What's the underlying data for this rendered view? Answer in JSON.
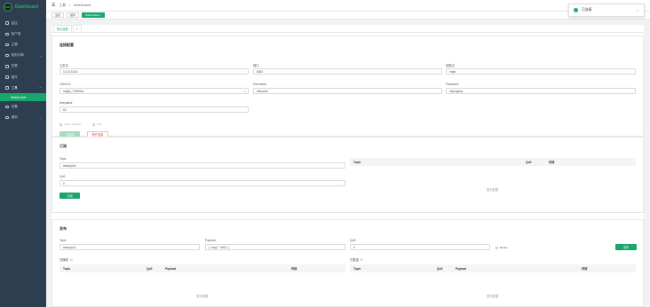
{
  "app": {
    "logo_mark": "EMQ",
    "logo_text": "Dashboard"
  },
  "sidebar": {
    "items": [
      {
        "label": "监控"
      },
      {
        "label": "客户端"
      },
      {
        "label": "主题"
      },
      {
        "label": "规则引擎"
      },
      {
        "label": "告警"
      },
      {
        "label": "插件"
      },
      {
        "label": "工具"
      },
      {
        "label": "设置"
      },
      {
        "label": "通用"
      }
    ],
    "sub_item": "WebSocket"
  },
  "header": {
    "crumb_tools": "工具",
    "separator": "/",
    "crumb_current": "WebSocket"
  },
  "tags": [
    "监控",
    "插件",
    "WebSocket"
  ],
  "tag_close": "×",
  "toast": {
    "message": "已连接",
    "close": "×",
    "check": "✓"
  },
  "connection_tabs": {
    "active": "默认连接",
    "add": "+"
  },
  "connect_card": {
    "title": "连接配置",
    "host_label": "主机名",
    "host_value": "10.10.16.81",
    "port_label": "端口",
    "port_value": "8083",
    "path_label": "挂载点",
    "path_value": "/mqtt",
    "client_id_label": "Client ID",
    "client_id_value": "mqttjs_7280f9ec",
    "username_label": "Username",
    "username_value": "hebanzhi",
    "password_label": "Password",
    "password_value": "mylongkey",
    "keepalive_label": "Keepalive",
    "keepalive_value": "60",
    "clean_session_label": "Clean Session",
    "ssl_label": "SSL",
    "connect_button": "已连接",
    "disconnect_button": "断开连接"
  },
  "subscribe_card": {
    "title": "订阅",
    "topic_label": "Topic",
    "topic_value": "testtopic/#",
    "qos_label": "QoS",
    "qos_value": "0",
    "subscribe_button": "订阅",
    "table_headers": [
      "Topic",
      "QoS",
      "时间"
    ],
    "empty_text": "暂无数据"
  },
  "publish_card": {
    "title": "发布",
    "topic_label": "Topic",
    "topic_value": "testtopic/1",
    "payload_label": "Payload",
    "payload_value": "{ \"msg\": \"hello\" }",
    "qos_label": "QoS",
    "qos_value": "0",
    "retain_label": "Retain",
    "publish_button": "发布",
    "received_label": "已接收",
    "sent_label": "已发送",
    "table_headers": [
      "Topic",
      "QoS",
      "Payload",
      "时间"
    ],
    "empty_text": "暂无数据"
  },
  "icons": {
    "chevron": "⌄",
    "refresh": "↻",
    "menu": "☰",
    "select_arrow": "⌄"
  },
  "colors": {
    "accent": "#1aa56c",
    "sidebar_bg": "#2c3e50",
    "danger": "#e74c3c"
  }
}
